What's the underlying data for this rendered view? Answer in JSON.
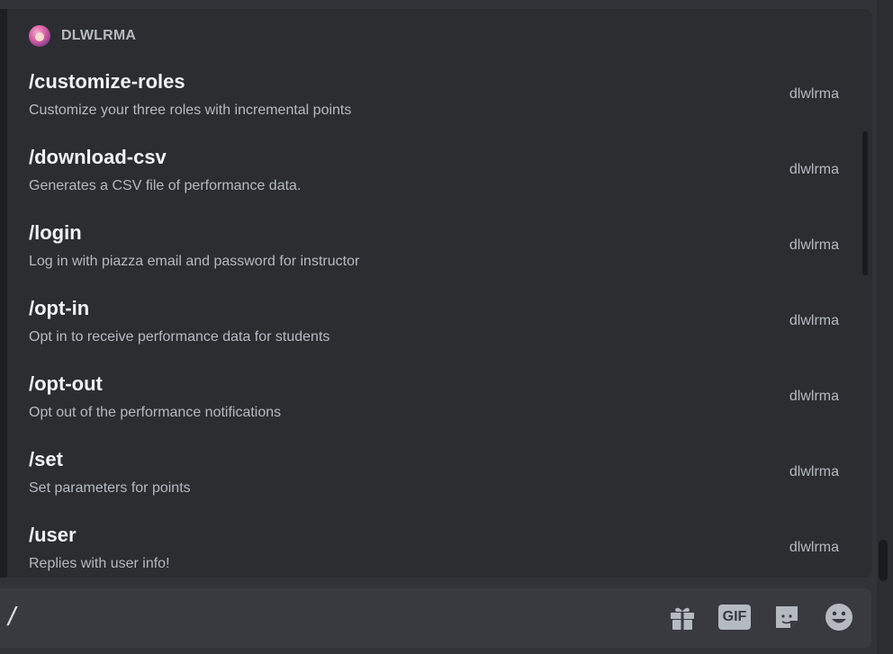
{
  "app": {
    "name": "DLWLRMA"
  },
  "commands": [
    {
      "name": "/customize-roles",
      "description": "Customize your three roles with incremental points",
      "source": "dlwlrma"
    },
    {
      "name": "/download-csv",
      "description": "Generates a CSV file of performance data.",
      "source": "dlwlrma"
    },
    {
      "name": "/login",
      "description": "Log in with piazza email and password for instructor",
      "source": "dlwlrma"
    },
    {
      "name": "/opt-in",
      "description": "Opt in to receive performance data for students",
      "source": "dlwlrma"
    },
    {
      "name": "/opt-out",
      "description": "Opt out of the performance notifications",
      "source": "dlwlrma"
    },
    {
      "name": "/set",
      "description": "Set parameters for points",
      "source": "dlwlrma"
    },
    {
      "name": "/user",
      "description": "Replies with user info!",
      "source": "dlwlrma"
    }
  ],
  "composer": {
    "value": "/",
    "icons": [
      "gift-icon",
      "gif-icon",
      "sticker-icon",
      "emoji-icon"
    ],
    "gif_label": "GIF"
  },
  "colors": {
    "background": "#313338",
    "popup": "#2b2d31",
    "composer": "#383a40",
    "text_primary": "#f2f3f5",
    "text_secondary": "#b5bac1"
  }
}
